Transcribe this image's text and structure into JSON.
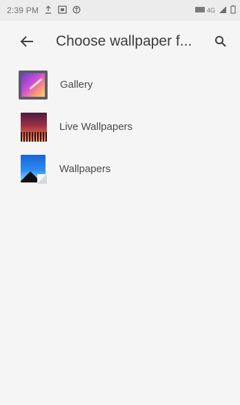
{
  "status_bar": {
    "time": "2:39 PM",
    "network_label": "4G"
  },
  "app_bar": {
    "title": "Choose wallpaper f..."
  },
  "list": {
    "items": [
      {
        "label": "Gallery",
        "icon": "gallery-icon"
      },
      {
        "label": "Live Wallpapers",
        "icon": "live-wallpapers-icon"
      },
      {
        "label": "Wallpapers",
        "icon": "wallpapers-icon"
      }
    ]
  }
}
